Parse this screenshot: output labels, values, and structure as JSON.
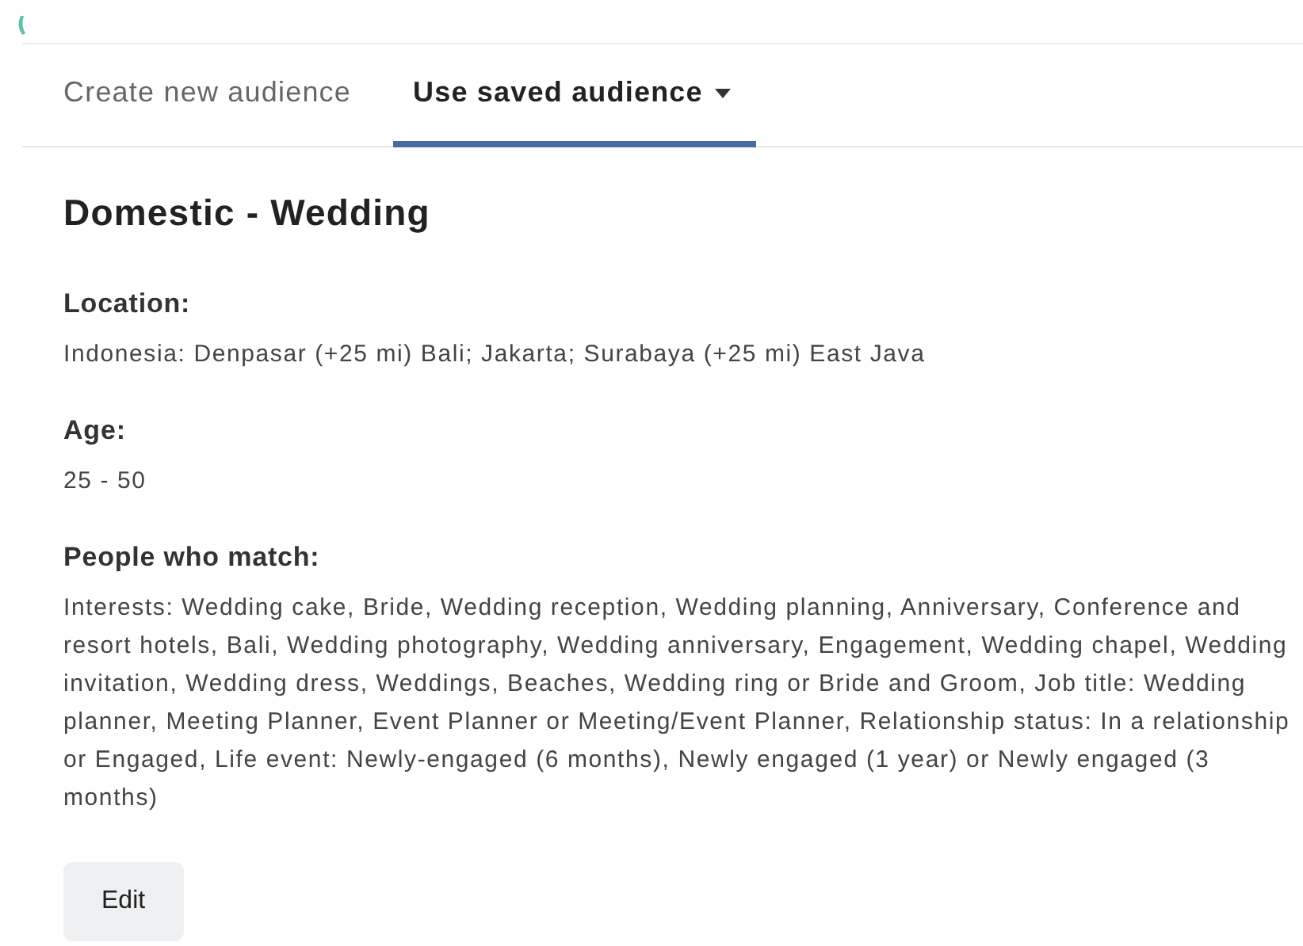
{
  "tabs": [
    {
      "label": "Create new audience",
      "selected": false,
      "dropdown": false
    },
    {
      "label": "Use saved audience",
      "selected": true,
      "dropdown": true
    }
  ],
  "audience": {
    "name": "Domestic - Wedding",
    "sections": [
      {
        "label": "Location:",
        "value": "Indonesia: Denpasar (+25 mi) Bali; Jakarta; Surabaya (+25 mi) East Java"
      },
      {
        "label": "Age:",
        "value": "25 - 50"
      },
      {
        "label": "People who match:",
        "value": "Interests: Wedding cake, Bride, Wedding reception, Wedding planning, Anniversary, Conference and resort hotels, Bali, Wedding photography, Wedding anniversary, Engagement, Wedding chapel, Wedding invitation, Wedding dress, Weddings, Beaches, Wedding ring or Bride and Groom, Job title: Wedding planner, Meeting Planner, Event Planner or Meeting/Event Planner, Relationship status: In a relationship or Engaged, Life event: Newly-engaged (6 months), Newly engaged (1 year) or Newly engaged (3 months)"
      }
    ]
  },
  "edit_button": "Edit"
}
